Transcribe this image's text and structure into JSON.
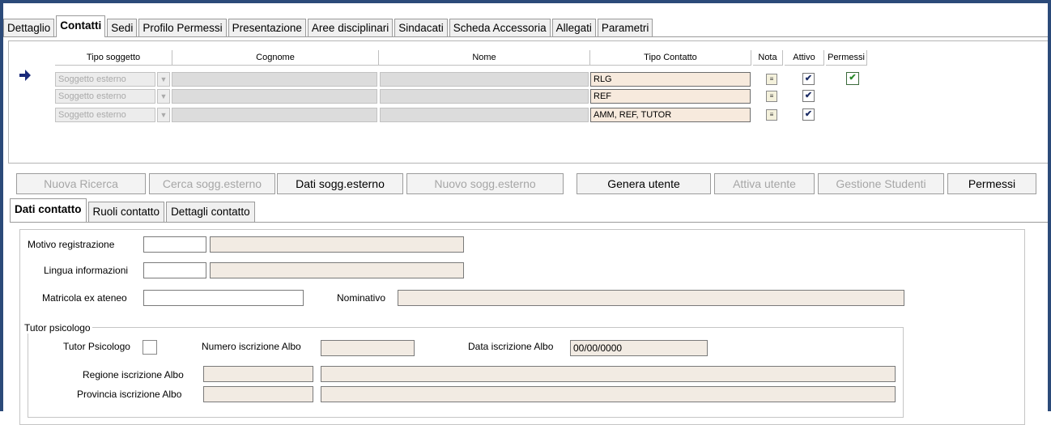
{
  "top_tabs": [
    "Dettaglio",
    "Contatti",
    "Sedi",
    "Profilo Permessi",
    "Presentazione",
    "Aree disciplinari",
    "Sindacati",
    "Scheda Accessoria",
    "Allegati",
    "Parametri"
  ],
  "grid": {
    "headers": {
      "tipo_soggetto": "Tipo soggetto",
      "cognome": "Cognome",
      "nome": "Nome",
      "tipo_contatto": "Tipo Contatto",
      "nota": "Nota",
      "attivo": "Attivo",
      "permessi": "Permessi"
    },
    "rows": [
      {
        "tipo_soggetto": "Soggetto esterno",
        "tipo_contatto": "RLG",
        "attivo": true,
        "permessi": true
      },
      {
        "tipo_soggetto": "Soggetto esterno",
        "tipo_contatto": "REF",
        "attivo": true,
        "permessi": false
      },
      {
        "tipo_soggetto": "Soggetto esterno",
        "tipo_contatto": "AMM, REF, TUTOR",
        "attivo": true,
        "permessi": false
      }
    ]
  },
  "buttons": {
    "nuova_ricerca": "Nuova Ricerca",
    "cerca_sogg_esterno": "Cerca sogg.esterno",
    "dati_sogg_esterno": "Dati sogg.esterno",
    "nuovo_sogg_esterno": "Nuovo sogg.esterno",
    "genera_utente": "Genera utente",
    "attiva_utente": "Attiva utente",
    "gestione_studenti": "Gestione Studenti",
    "permessi": "Permessi"
  },
  "sub_tabs": [
    "Dati contatto",
    "Ruoli contatto",
    "Dettagli contatto"
  ],
  "form": {
    "motivo_registrazione": "Motivo registrazione",
    "lingua_informazioni": "Lingua informazioni",
    "matricola_ex_ateneo": "Matricola ex ateneo",
    "nominativo": "Nominativo",
    "tutor_group": "Tutor psicologo",
    "tutor_psicologo": "Tutor Psicologo",
    "numero_iscrizione_albo": "Numero iscrizione Albo",
    "data_iscrizione_albo": "Data iscrizione Albo",
    "data_iscrizione_value": "00/00/0000",
    "regione_iscrizione_albo": "Regione iscrizione Albo",
    "provincia_iscrizione_albo": "Provincia iscrizione Albo"
  },
  "colors": {
    "frame": "#2b4a79",
    "tipo_contatto_bg": "#f7eadd",
    "field_beige": "#f2ebe3",
    "arrow": "#1a2a7a"
  }
}
